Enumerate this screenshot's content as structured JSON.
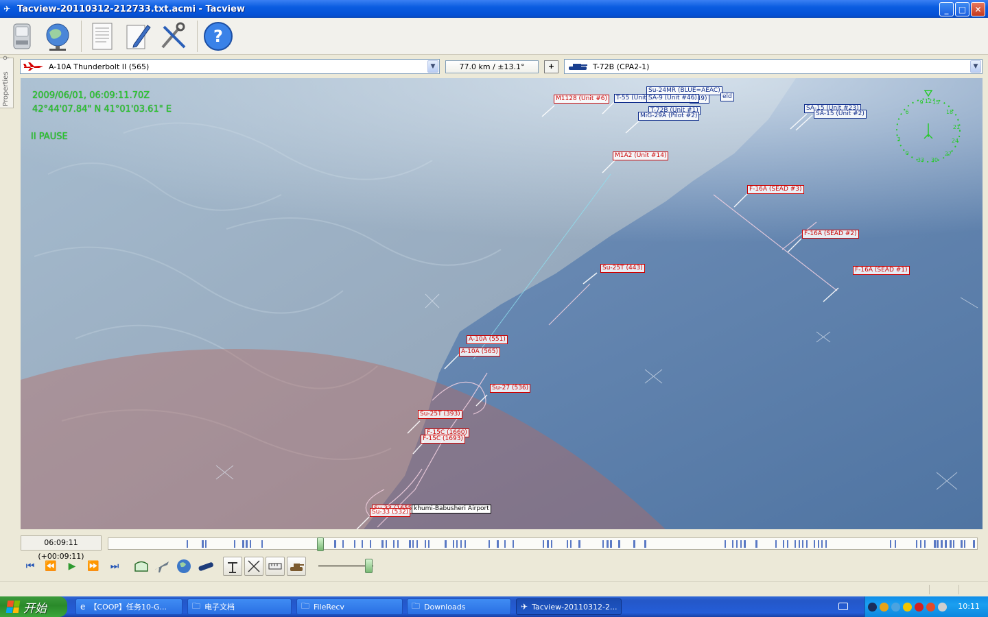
{
  "window": {
    "title": "Tacview-20110312-212733.txt.acmi - Tacview",
    "buttons": {
      "minimize": "_",
      "maximize": "□",
      "close": "✕"
    }
  },
  "toolbar": {
    "items": [
      "open-file-icon",
      "globe-network-icon",
      "document-icon",
      "notepad-edit-icon",
      "tools-icon",
      "help-icon"
    ],
    "help_glyph": "?"
  },
  "properties_tab": {
    "label": "Properties"
  },
  "selection": {
    "primary": "A-10A Thunderbolt II (565)",
    "range": "77.0 km / ±13.1°",
    "plus": "+",
    "secondary": "T-72B (CPA2-1)"
  },
  "hud": {
    "datetime": "2009/06/01, 06:09:11.70Z",
    "coords": "42°44'07.84\" N  41°01'03.61\" E",
    "status": "II PAUSE"
  },
  "labels": {
    "m1128": "M1128 (Unit #6)",
    "t55": "T-55 (Unit",
    "su24": "Su-24MR (BLUE=AEAC)",
    "sa9": "SA-9 (Unit #46)",
    "unit49": "#49)",
    "feld": "eld",
    "t72b": "T-72B (Unit #1)",
    "mig29": "MiG-29A (Pilot #2)",
    "sa15a": "SA-15 (Unit #23)",
    "sa15b": "SA-15 (Unit #2)",
    "m1a2": "M1A2 (Unit #14)",
    "f16_3": "F-16A (SEAD #3)",
    "f16_2": "F-16A (SEAD #2)",
    "f16_1": "F-16A (SEAD #1)",
    "su25_443": "Su-25T (443)",
    "a10_551": "A-10A (551)",
    "a10_565": "A-10A (565)",
    "su27": "Su-27 (536)",
    "su25_393": "Su-25T (393)",
    "f15_1660": "F-15C (1660)",
    "f15_1693": "F-15C (1693)",
    "su33_back": "Su-33 (1655)",
    "su33": "Su-33 (532)",
    "airport": "khumi-Babusheri Airport"
  },
  "compass": {
    "ticks": [
      "0",
      "3",
      "6",
      "9",
      "12",
      "15",
      "18",
      "21",
      "24",
      "27",
      "30",
      "33"
    ]
  },
  "playback": {
    "time": "06:09:11 (+00:09:11)",
    "position_fraction": 0.24,
    "speed_fraction": 0.9,
    "controls": [
      "skip-start-icon",
      "rewind-icon",
      "play-icon",
      "fast-forward-icon",
      "skip-end-icon"
    ],
    "view_buttons": [
      "cockpit-view-icon",
      "aircraft-view-icon",
      "globe-view-icon",
      "satellite-view-icon",
      "radar-icon",
      "weapons-icon",
      "ruler-icon",
      "tank-icon"
    ]
  },
  "taskbar": {
    "start": "开始",
    "tasks": [
      "【COOP】任务10-G...",
      "电子文档",
      "FileRecv",
      "Downloads",
      "Tacview-20110312-2..."
    ],
    "clock": "10:11"
  },
  "colors": {
    "hud_green": "#27c92a",
    "red_label": "#cc0000",
    "blue_label": "#0d2b8a",
    "xp_blue": "#245dd8"
  }
}
